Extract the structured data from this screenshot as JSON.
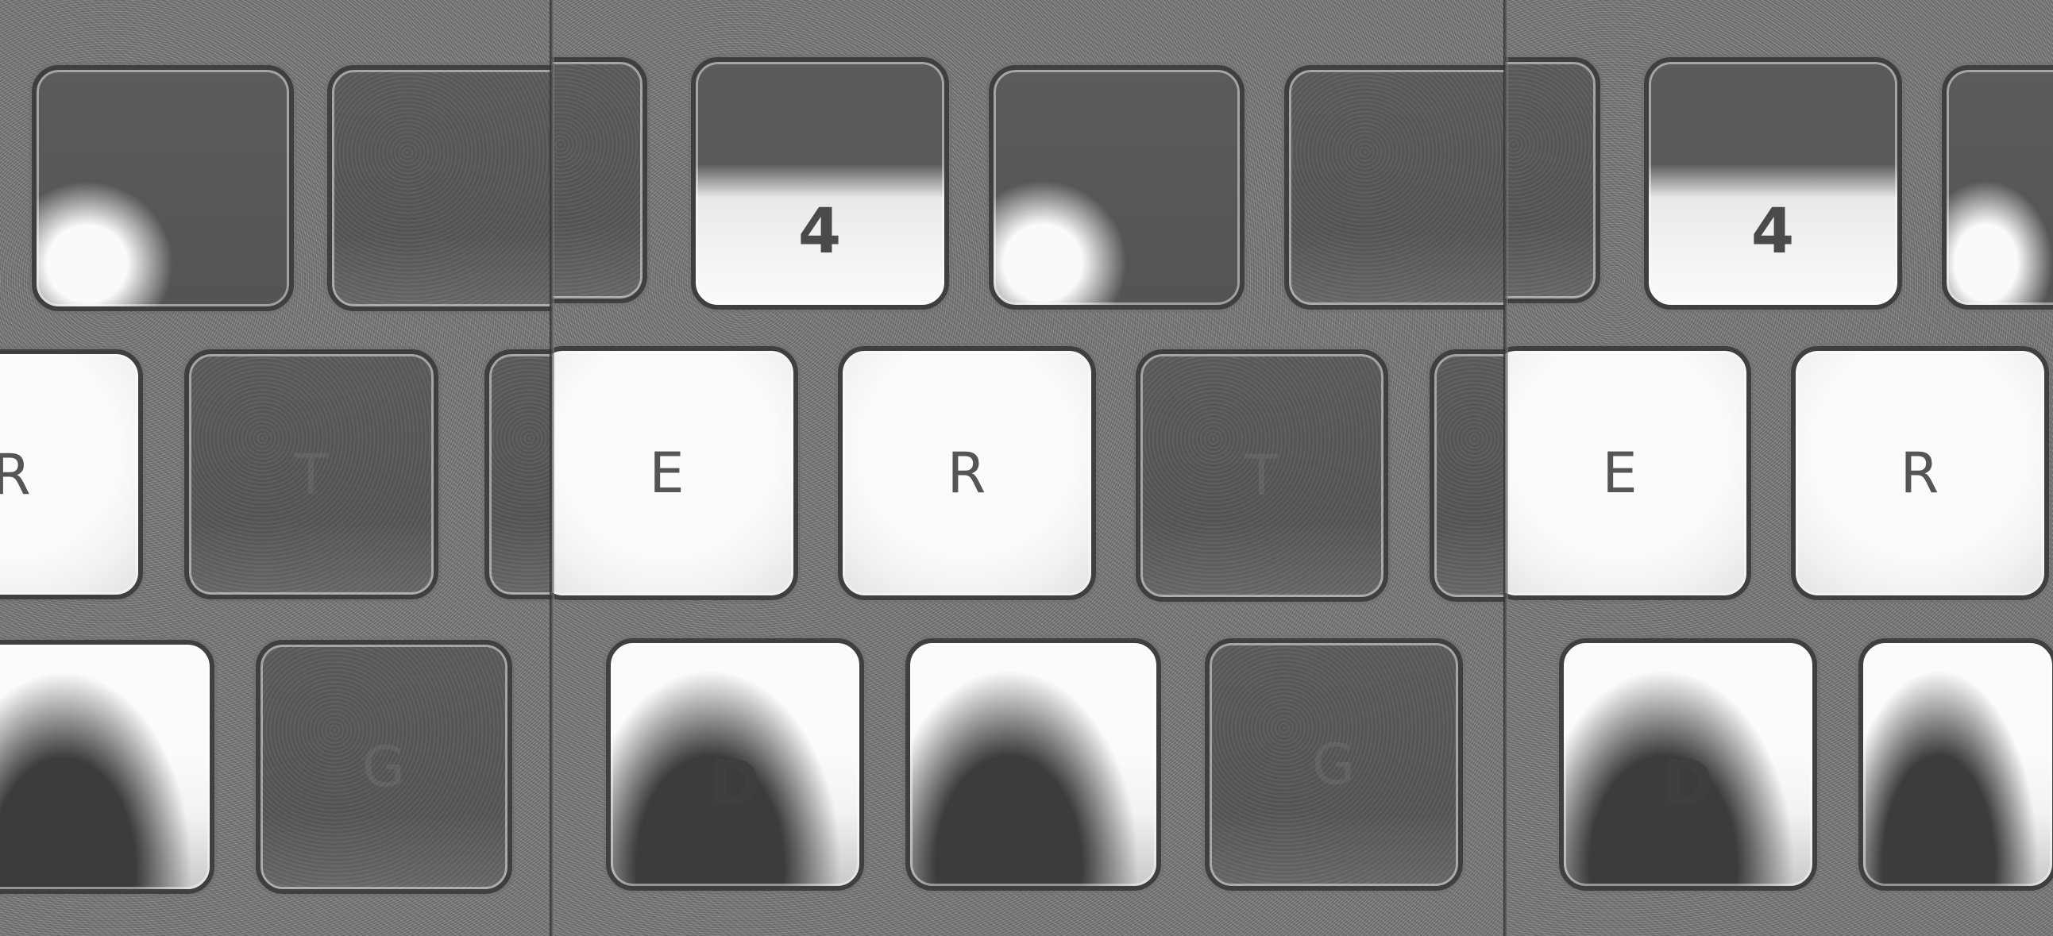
{
  "image": {
    "panels": [
      {
        "keys": [
          {
            "legend": "",
            "tone": "smudge"
          },
          {
            "legend": "",
            "tone": "dark"
          },
          {
            "legend": "R",
            "tone": "light"
          },
          {
            "legend": "T",
            "tone": "dark"
          },
          {
            "legend": "",
            "tone": "lower-dark"
          },
          {
            "legend": "G",
            "tone": "dark"
          }
        ]
      },
      {
        "keys": [
          {
            "legend": "",
            "tone": "dark"
          },
          {
            "legend": "4",
            "tone": "half"
          },
          {
            "legend": "",
            "tone": "smudge"
          },
          {
            "legend": "",
            "tone": "dark"
          },
          {
            "legend": "E",
            "tone": "light"
          },
          {
            "legend": "R",
            "tone": "light"
          },
          {
            "legend": "T",
            "tone": "dark"
          },
          {
            "legend": "D",
            "tone": "lower-dark"
          },
          {
            "legend": "",
            "tone": "lower-dark"
          },
          {
            "legend": "G",
            "tone": "dark"
          }
        ]
      },
      {
        "keys": [
          {
            "legend": "",
            "tone": "dark"
          },
          {
            "legend": "4",
            "tone": "half"
          },
          {
            "legend": "",
            "tone": "smudge"
          },
          {
            "legend": "E",
            "tone": "light"
          },
          {
            "legend": "R",
            "tone": "light"
          },
          {
            "legend": "D",
            "tone": "lower-dark"
          },
          {
            "legend": "",
            "tone": "lower-dark"
          }
        ]
      }
    ]
  }
}
